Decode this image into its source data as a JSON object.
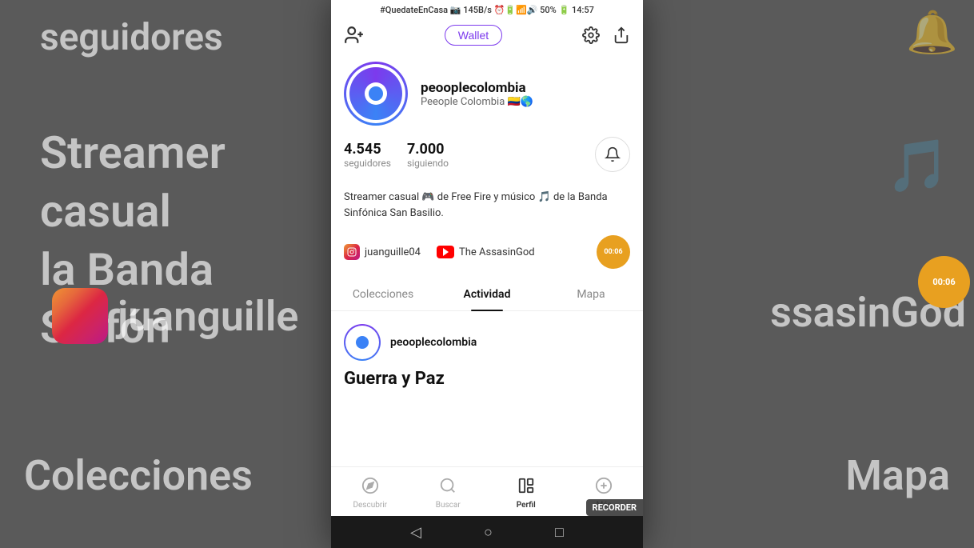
{
  "status_bar": {
    "hashtag": "#QuedateEnCasa",
    "network": "145B/s",
    "time": "14:57",
    "battery": "50%"
  },
  "top_bar": {
    "wallet_label": "Wallet",
    "add_user_label": "Add User"
  },
  "profile": {
    "username": "peooplecolombia",
    "display_name": "Peeople Colombia",
    "flag_emojis": "🇨🇴🌎",
    "followers_count": "4.545",
    "followers_label": "seguidores",
    "following_count": "7.000",
    "following_label": "siguiendo",
    "bio": "Streamer casual 🎮 de Free Fire  y músico 🎵 de la Banda Sinfónica San Basilio."
  },
  "social_links": [
    {
      "platform": "instagram",
      "handle": "juanguille04"
    },
    {
      "platform": "youtube",
      "handle": "The AssasinGod"
    }
  ],
  "tabs": [
    {
      "id": "colecciones",
      "label": "Colecciones",
      "active": false
    },
    {
      "id": "actividad",
      "label": "Actividad",
      "active": true
    },
    {
      "id": "mapa",
      "label": "Mapa",
      "active": false
    }
  ],
  "activity": {
    "user": "peooplecolombia",
    "post_title": "Guerra y Paz"
  },
  "bottom_nav": [
    {
      "id": "descubrir",
      "label": "Descubrir",
      "icon": "compass",
      "active": false
    },
    {
      "id": "buscar",
      "label": "Buscar",
      "icon": "search",
      "active": false
    },
    {
      "id": "perfil",
      "label": "Perfil",
      "icon": "grid",
      "active": true
    },
    {
      "id": "more",
      "label": "Más",
      "icon": "plus",
      "active": false
    }
  ],
  "timer": "00:06",
  "recorder_label": "RECORDER",
  "background": {
    "text1": "seguidores",
    "text2": "Streamer casual",
    "text3": "la Banda Sinfón",
    "text4": "juanguille",
    "text5": "ssasinGod",
    "text6": "Colecciones",
    "text7": "Mapa",
    "music_note": "🎵",
    "timer_bg": "00:06"
  }
}
